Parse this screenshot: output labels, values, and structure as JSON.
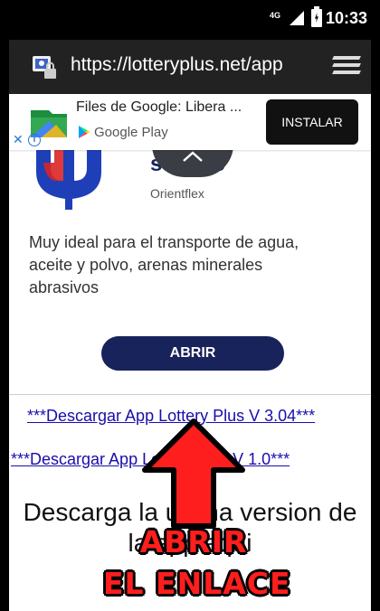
{
  "status_bar": {
    "network": "4G",
    "time": "10:33"
  },
  "browser": {
    "url": "https://lotteryplus.net/app"
  },
  "ad": {
    "title": "Files de Google: Libera ...",
    "store": "Google Play",
    "install_label": "INSTALAR"
  },
  "card": {
    "product_title": "s n pvc",
    "company": "Orientflex",
    "description": "Muy ideal para el transporte de agua, aceite y polvo, arenas minerales abrasivos",
    "open_label": "ABRIR"
  },
  "content": {
    "link_1": "***Descargar App Lottery Plus V 3.04***",
    "link_2": "***Descargar App Lottery Plus V 1.0***",
    "heading_line1": "Descarga la ultima version de",
    "heading_line2": "la app aqui"
  },
  "overlay": {
    "line1": "ABRIR",
    "line2": "EL ENLACE"
  },
  "colors": {
    "accent": "#17235a",
    "overlay_red": "#ff1e1e",
    "link": "#1a0dab"
  }
}
